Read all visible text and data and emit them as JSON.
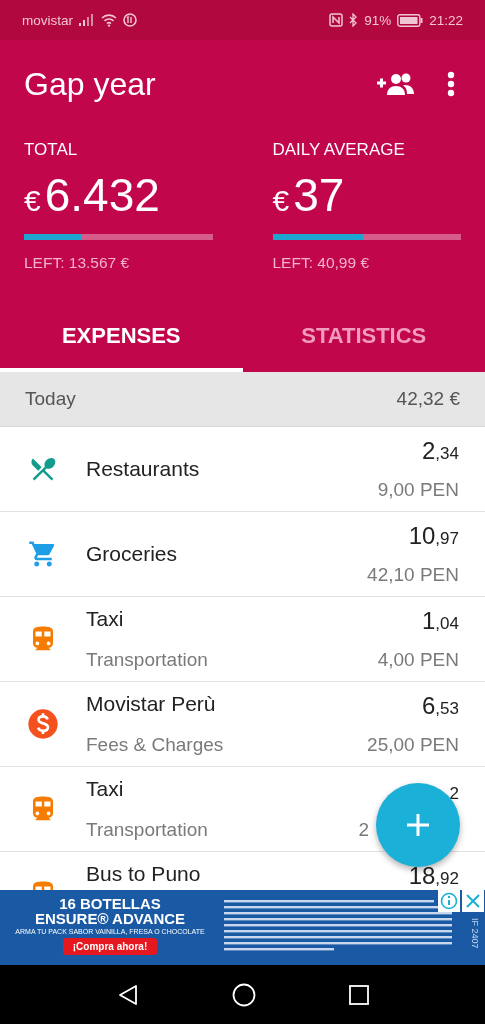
{
  "status_bar": {
    "carrier": "movistar",
    "battery": "91%",
    "time": "21:22"
  },
  "app_bar": {
    "title": "Gap year"
  },
  "summary": [
    {
      "label": "TOTAL",
      "currency": "€",
      "value": "6.432",
      "level": 0.3,
      "left": "LEFT: 13.567 €"
    },
    {
      "label": "DAILY AVERAGE",
      "currency": "€",
      "value": "37",
      "level": 0.48,
      "left": "LEFT: 40,99 €"
    }
  ],
  "tabs": [
    {
      "label": "EXPENSES",
      "selected": true
    },
    {
      "label": "STATISTICS",
      "selected": false
    }
  ],
  "day": {
    "label": "Today",
    "total": "42,32 €"
  },
  "expenses": [
    {
      "kind": "restaurant",
      "color": "#129c8c",
      "title": "Restaurants",
      "amount": "2",
      "cents": ",34",
      "original": "9,00 PEN"
    },
    {
      "kind": "cart",
      "color": "#1e9ee6",
      "title": "Groceries",
      "amount": "10",
      "cents": ",97",
      "original": "42,10 PEN"
    },
    {
      "kind": "train",
      "color": "#f57c00",
      "title": "Taxi",
      "category": "Transportation",
      "amount": "1",
      "cents": ",04",
      "original": "4,00 PEN"
    },
    {
      "kind": "dollar",
      "color": "#f4511e",
      "title": "Movistar Perù",
      "category": "Fees & Charges",
      "amount": "6",
      "cents": ",53",
      "original": "25,00 PEN"
    },
    {
      "kind": "train",
      "color": "#f57c00",
      "title": "Taxi",
      "category": "Transportation",
      "cents": "2",
      "original": "2"
    },
    {
      "kind": "train",
      "color": "#f57c00",
      "title": "Bus to Puno",
      "amount": "18",
      "cents": ",92"
    }
  ],
  "ad": {
    "headline": "16 BOTELLAS",
    "product": "ENSURE® ADVANCE",
    "tagline": "ARMA TU PACK SABOR VAINILLA, FRESA O CHOCOLATE",
    "button": "¡Compra ahora!",
    "code": "IF 2407"
  }
}
